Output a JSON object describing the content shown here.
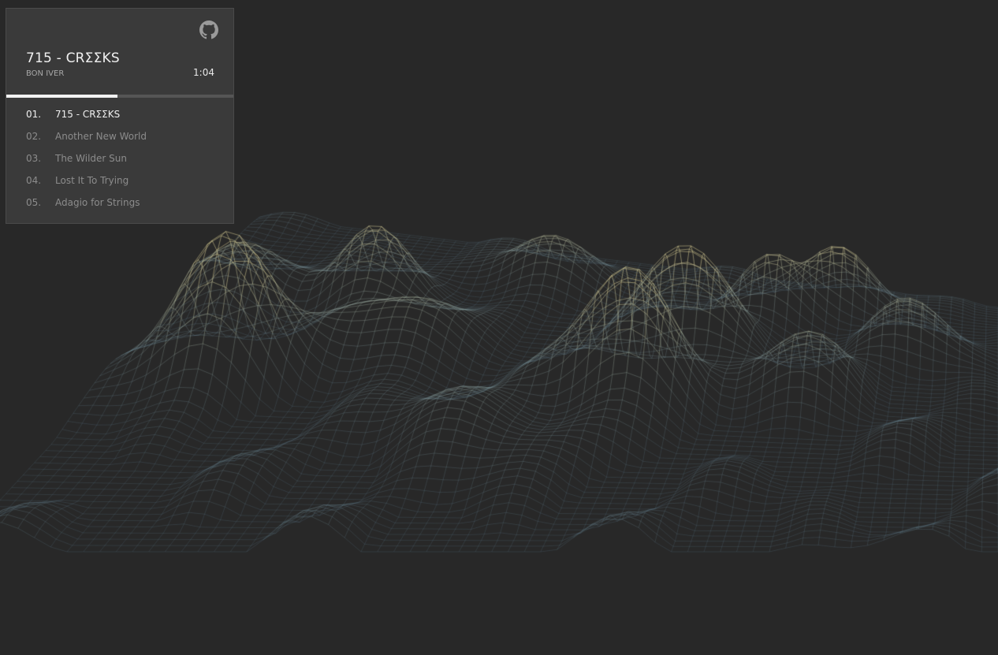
{
  "now_playing": {
    "title": "715 - CRΣΣKS",
    "artist": "BON IVER",
    "time": "1:04",
    "progress": 0.49
  },
  "playlist": [
    {
      "num": "01.",
      "title": "715 - CRΣΣKS",
      "active": true
    },
    {
      "num": "02.",
      "title": "Another New World",
      "active": false
    },
    {
      "num": "03.",
      "title": "The Wilder Sun",
      "active": false
    },
    {
      "num": "04.",
      "title": "Lost It To Trying",
      "active": false
    },
    {
      "num": "05.",
      "title": "Adagio for Strings",
      "active": false
    }
  ],
  "icons": {
    "github": "github-icon"
  },
  "colors": {
    "background": "#282828",
    "mesh_low": "#7fa6bd",
    "mesh_high": "#e8dfa8"
  }
}
